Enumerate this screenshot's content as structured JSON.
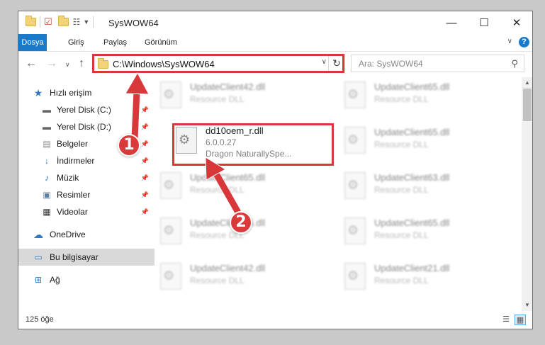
{
  "window": {
    "title": "SysWOW64",
    "minimize": "—",
    "maximize": "☐",
    "close": "✕"
  },
  "ribbon": {
    "tabs": [
      "Dosya",
      "Giriş",
      "Paylaş",
      "Görünüm"
    ],
    "help": "?"
  },
  "address": {
    "path": "C:\\Windows\\SysWOW64",
    "search_placeholder": "Ara: SysWOW64"
  },
  "sidebar": {
    "quick_access": "Hızlı erişim",
    "items": [
      {
        "label": "Yerel Disk (C:)",
        "icon": "drive-icon"
      },
      {
        "label": "Yerel Disk (D:)",
        "icon": "drive-icon"
      },
      {
        "label": "Belgeler",
        "icon": "documents-icon"
      },
      {
        "label": "İndirmeler",
        "icon": "downloads-icon"
      },
      {
        "label": "Müzik",
        "icon": "music-icon"
      },
      {
        "label": "Resimler",
        "icon": "pictures-icon"
      },
      {
        "label": "Videolar",
        "icon": "videos-icon"
      }
    ],
    "onedrive": "OneDrive",
    "this_pc": "Bu bilgisayar",
    "network": "Ağ"
  },
  "files": {
    "highlighted": {
      "name": "dd10oem_r.dll",
      "version": "6.0.0.27",
      "description": "Dragon NaturallySpe..."
    },
    "left_column": [
      {
        "name": "UpdateClient42.dll",
        "type": "Resource DLL"
      },
      {
        "name": "UpdateClient65.dll",
        "type": "Resource DLL"
      },
      {
        "name": "UpdateClient65.dll",
        "type": "Resource DLL"
      },
      {
        "name": "UpdateClient42.dll",
        "type": "Resource DLL"
      }
    ],
    "right_column": [
      {
        "name": "UpdateClient65.dll",
        "type": "Resource DLL"
      },
      {
        "name": "UpdateClient65.dll",
        "type": "Resource DLL"
      },
      {
        "name": "UpdateClient63.dll",
        "type": "Resource DLL"
      },
      {
        "name": "UpdateClient65.dll",
        "type": "Resource DLL"
      },
      {
        "name": "UpdateClient21.dll",
        "type": "Resource DLL"
      }
    ]
  },
  "status": {
    "count": "125 öğe"
  },
  "callouts": [
    "1",
    "2"
  ],
  "colors": {
    "accent": "#1979ca",
    "highlight": "#d9383a"
  }
}
